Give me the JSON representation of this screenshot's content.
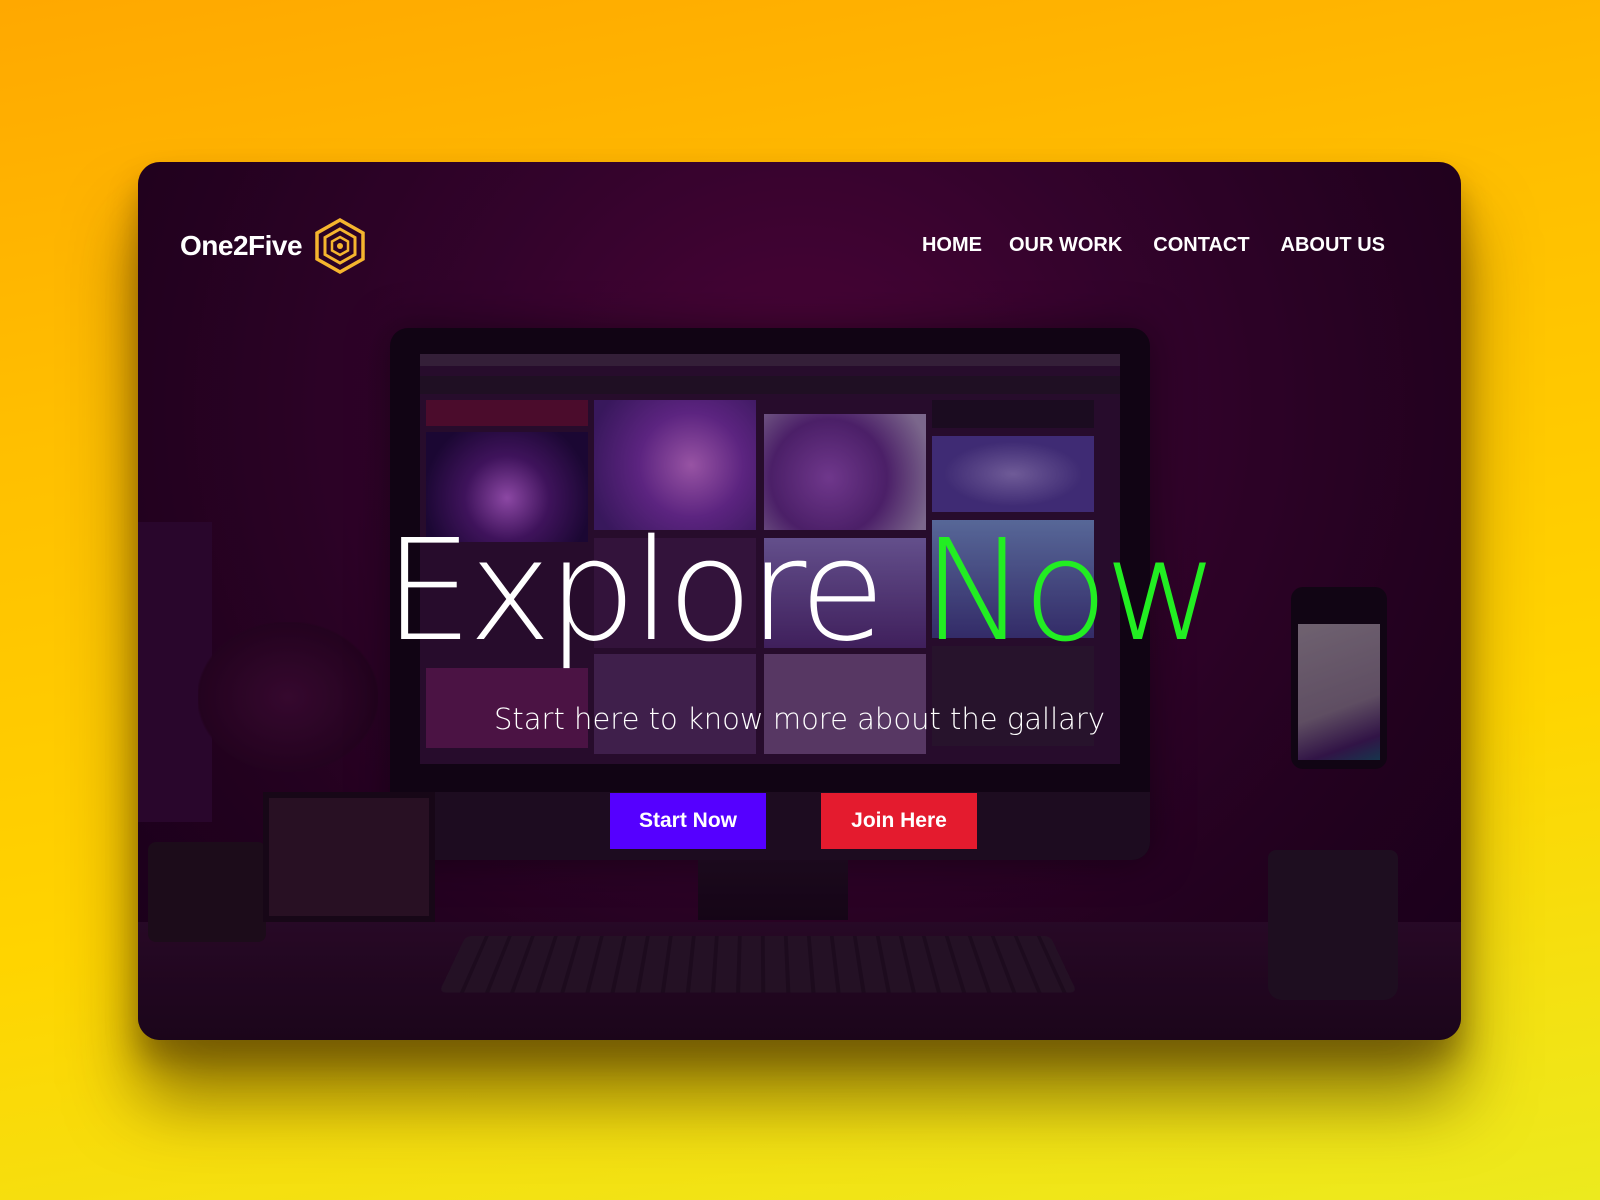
{
  "brand": {
    "name": "One2Five",
    "logo_icon": "hexagon-logo-icon",
    "logo_color": "#f5b52e"
  },
  "nav": {
    "items": [
      {
        "label": "HOME"
      },
      {
        "label": "OUR WORK"
      },
      {
        "label": "CONTACT"
      },
      {
        "label": "ABOUT US"
      }
    ]
  },
  "hero": {
    "title_word1": "Explore",
    "title_word2": "Now",
    "title_word2_color": "#22ee22",
    "subtitle": "Start here to know more about the gallary"
  },
  "buttons": {
    "primary": {
      "label": "Start Now",
      "color": "#5500ff"
    },
    "secondary": {
      "label": "Join Here",
      "color": "#e41b2e"
    }
  },
  "colors": {
    "page_background": "#ffc107",
    "card_background": "#2a0328"
  }
}
